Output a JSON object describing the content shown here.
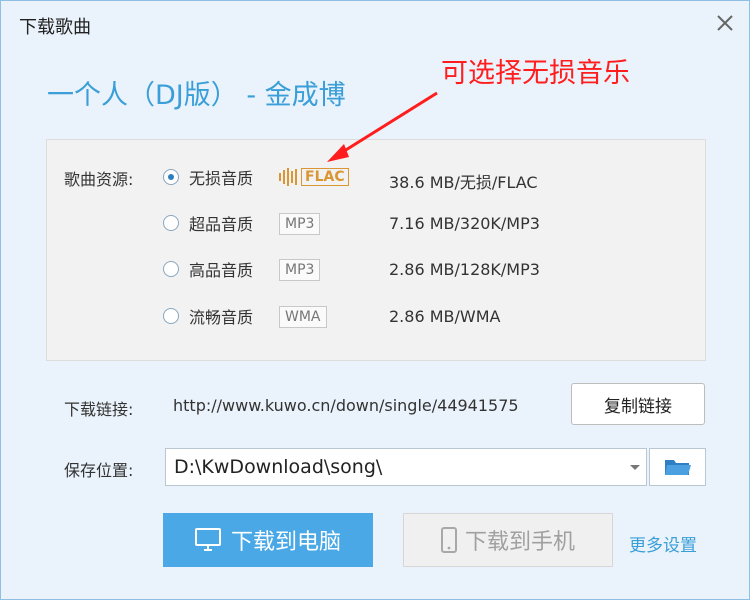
{
  "window": {
    "title": "下载歌曲"
  },
  "song": {
    "title": "一个人（DJ版） - 金成博"
  },
  "annotation": {
    "text": "可选择无损音乐",
    "color": "#ff1d1d"
  },
  "source": {
    "label": "歌曲资源:",
    "options": [
      {
        "label": "无损音质",
        "format": "FLAC",
        "size": "38.6 MB/无损/FLAC",
        "selected": true
      },
      {
        "label": "超品音质",
        "format": "MP3",
        "size": "7.16 MB/320K/MP3",
        "selected": false
      },
      {
        "label": "高品音质",
        "format": "MP3",
        "size": "2.86 MB/128K/MP3",
        "selected": false
      },
      {
        "label": "流畅音质",
        "format": "WMA",
        "size": "2.86 MB/WMA",
        "selected": false
      }
    ]
  },
  "link": {
    "label": "下载链接:",
    "url": "http://www.kuwo.cn/down/single/44941575",
    "copy_button": "复制链接"
  },
  "save": {
    "label": "保存位置:",
    "path": "D:\\KwDownload\\song\\"
  },
  "actions": {
    "download_pc": "下载到电脑",
    "download_phone": "下载到手机",
    "more_settings": "更多设置"
  },
  "colors": {
    "accent": "#3a9ed8",
    "primary_button": "#4aa8e6",
    "flac_badge": "#d99633"
  },
  "icons": [
    "close-icon",
    "monitor-icon",
    "phone-icon",
    "folder-icon",
    "dropdown-arrow-icon"
  ]
}
